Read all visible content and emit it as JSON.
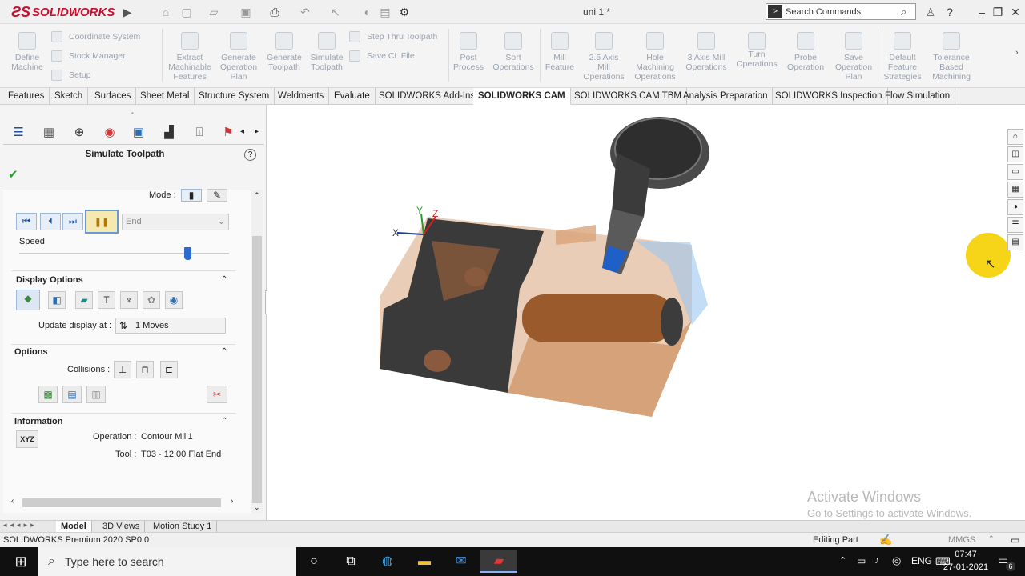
{
  "app": {
    "logo_text": "SOLIDWORKS",
    "document_title": "uni 1 *",
    "search_placeholder": "Search Commands"
  },
  "command_manager": {
    "small_left": [
      "Coordinate System",
      "Stock Manager",
      "Setup"
    ],
    "define_machine": [
      "Define",
      "Machine"
    ],
    "big": [
      {
        "lines": [
          "Extract",
          "Machinable",
          "Features"
        ]
      },
      {
        "lines": [
          "Generate",
          "Operation",
          "Plan"
        ]
      },
      {
        "lines": [
          "Generate",
          "Toolpath"
        ]
      },
      {
        "lines": [
          "Simulate",
          "Toolpath"
        ]
      }
    ],
    "small_mid": [
      "Step Thru Toolpath",
      "Save CL File"
    ],
    "big2": [
      {
        "lines": [
          "Post",
          "Process"
        ]
      },
      {
        "lines": [
          "Sort",
          "Operations"
        ]
      },
      {
        "lines": [
          "Mill",
          "Feature"
        ]
      },
      {
        "lines": [
          "2.5 Axis",
          "Mill",
          "Operations"
        ]
      },
      {
        "lines": [
          "Hole",
          "Machining",
          "Operations"
        ]
      },
      {
        "lines": [
          "3 Axis Mill",
          "Operations"
        ]
      },
      {
        "lines": [
          "Turn",
          "Operations"
        ]
      },
      {
        "lines": [
          "Probe",
          "Operation"
        ]
      },
      {
        "lines": [
          "Save",
          "Operation",
          "Plan"
        ]
      },
      {
        "lines": [
          "Default",
          "Feature",
          "Strategies"
        ]
      },
      {
        "lines": [
          "Tolerance",
          "Based",
          "Machining"
        ]
      }
    ]
  },
  "tabs": [
    "Features",
    "Sketch",
    "Surfaces",
    "Sheet Metal",
    "Structure System",
    "Weldments",
    "Evaluate",
    "SOLIDWORKS Add-Ins",
    "SOLIDWORKS CAM",
    "SOLIDWORKS CAM TBM",
    "Analysis Preparation",
    "SOLIDWORKS Inspection",
    "Flow Simulation"
  ],
  "active_tab": "SOLIDWORKS CAM",
  "property_manager": {
    "title": "Simulate Toolpath",
    "mode_label": "Mode :",
    "end_value": "End",
    "speed_label": "Speed",
    "speed_level_percent": 80,
    "display_options_header": "Display Options",
    "update_display_label": "Update display at :",
    "update_display_value": "1 Moves",
    "options_header": "Options",
    "collisions_label": "Collisions :",
    "information_header": "Information",
    "xyz_label": "XYZ",
    "operation_label": "Operation :",
    "operation_value": "Contour Mill1",
    "tool_label": "Tool :",
    "tool_value": "T03 - 12.00 Flat End"
  },
  "bottom_tabs": [
    "Model",
    "3D Views",
    "Motion Study 1"
  ],
  "status": {
    "left": "SOLIDWORKS Premium 2020 SP0.0",
    "editing": "Editing Part",
    "units": "MMGS"
  },
  "watermark": {
    "line1": "Activate Windows",
    "line2": "Go to Settings to activate Windows."
  },
  "taskbar": {
    "search_placeholder": "Type here to search",
    "lang": "ENG",
    "time": "07:47",
    "date": "27-01-2021",
    "notification_count": "6"
  },
  "colors": {
    "accent": "#c8102e",
    "stock": "#d9a47a",
    "part": "#3a3a3a",
    "cursor_highlight": "#f5d000"
  },
  "axes": {
    "x": "X",
    "y": "Y",
    "z": "Z"
  }
}
